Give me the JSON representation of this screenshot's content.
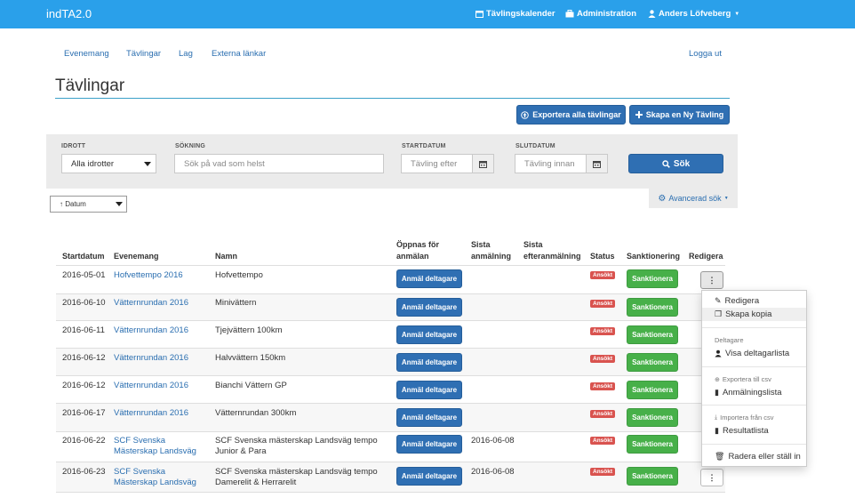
{
  "header": {
    "brand": "indTA2.0",
    "calendar": "Tävlingskalender",
    "admin": "Administration",
    "user": "Anders Löfveberg"
  },
  "subnav": {
    "events": "Evenemang",
    "competitions": "Tävlingar",
    "teams": "Lag",
    "external": "Externa länkar",
    "logout": "Logga ut"
  },
  "page": {
    "title": "Tävlingar",
    "export_all": "Exportera alla tävlingar",
    "create_new": "Skapa en Ny Tävling"
  },
  "filters": {
    "sport_label": "IDROTT",
    "sport_value": "Alla idrotter",
    "search_label": "SÖKNING",
    "search_placeholder": "Sök på vad som helst",
    "start_label": "STARTDATUM",
    "start_placeholder": "Tävling efter",
    "end_label": "SLUTDATUM",
    "end_placeholder": "Tävling innan",
    "search_button": "Sök",
    "advanced": "Avancerad sök",
    "sort_value": "↑ Datum"
  },
  "table": {
    "headers": {
      "start": "Startdatum",
      "event": "Evenemang",
      "name": "Namn",
      "open_1": "Öppnas för",
      "open_2": "anmälan",
      "last_1": "Sista",
      "last_2": "anmälning",
      "late_1": "Sista",
      "late_2": "efteranmälning",
      "status": "Status",
      "sanction": "Sanktionering",
      "edit": "Redigera"
    },
    "register_label": "Anmäl deltagare",
    "status_label": "Ansökt",
    "sanction_label": "Sanktionera",
    "rows": [
      {
        "date": "2016-05-01",
        "event_1": "Hofvettempo 2016",
        "event_2": "",
        "name_1": "Hofvettempo",
        "name_2": "",
        "last": ""
      },
      {
        "date": "2016-06-10",
        "event_1": "Vätternrundan 2016",
        "event_2": "",
        "name_1": "Minivättern",
        "name_2": "",
        "last": ""
      },
      {
        "date": "2016-06-11",
        "event_1": "Vätternrundan 2016",
        "event_2": "",
        "name_1": "Tjejvättern 100km",
        "name_2": "",
        "last": ""
      },
      {
        "date": "2016-06-12",
        "event_1": "Vätternrundan 2016",
        "event_2": "",
        "name_1": "Halvvättern 150km",
        "name_2": "",
        "last": ""
      },
      {
        "date": "2016-06-12",
        "event_1": "Vätternrundan 2016",
        "event_2": "",
        "name_1": "Bianchi Vättern GP",
        "name_2": "",
        "last": ""
      },
      {
        "date": "2016-06-17",
        "event_1": "Vätternrundan 2016",
        "event_2": "",
        "name_1": "Vätternrundan 300km",
        "name_2": "",
        "last": ""
      },
      {
        "date": "2016-06-22",
        "event_1": "SCF Svenska",
        "event_2": "Mästerskap Landsväg",
        "name_1": "SCF Svenska mästerskap Landsväg tempo",
        "name_2": "Junior & Para",
        "last": "2016-06-08"
      },
      {
        "date": "2016-06-23",
        "event_1": "SCF Svenska",
        "event_2": "Mästerskap Landsväg",
        "name_1": "SCF Svenska mästerskap Landsväg tempo",
        "name_2": "Damerelit & Herrarelit",
        "last": "2016-06-08"
      }
    ]
  },
  "dropdown": {
    "edit": "Redigera",
    "copy": "Skapa kopia",
    "participants_header": "Deltagare",
    "show_participants": "Visa deltagarlista",
    "export_header": "Exportera till csv",
    "registration_list": "Anmälningslista",
    "import_header": "Importera från csv",
    "result_list": "Resultatlista",
    "delete": "Radera eller ställ in"
  },
  "colors": {
    "topbar": "#2aa0ea",
    "primary": "#2f6fb3",
    "success": "#47b049",
    "danger": "#d9534f",
    "link": "#2a6eb0"
  }
}
